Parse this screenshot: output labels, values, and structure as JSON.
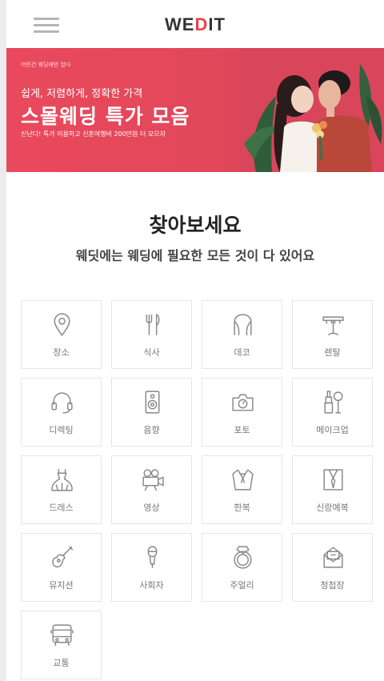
{
  "header": {
    "logo_pre": "WE",
    "logo_accent": "D",
    "logo_post": "IT"
  },
  "banner": {
    "small_text": "어린건 웨딩에만 있다",
    "subtitle": "쉽게, 저렴하게, 정확한 가격",
    "title": "스몰웨딩 특가 모음",
    "description": "신난다! 특가 이용하고 신혼여행비 200만원 더 모으자"
  },
  "section": {
    "heading": "찾아보세요",
    "subheading": "웨딧에는 웨딩에 필요한 모든 것이 다 있어요"
  },
  "categories": [
    {
      "label": "장소",
      "icon": "location-pin-icon"
    },
    {
      "label": "식사",
      "icon": "fork-knife-icon"
    },
    {
      "label": "데코",
      "icon": "arch-curtain-icon"
    },
    {
      "label": "렌탈",
      "icon": "table-rental-icon"
    },
    {
      "label": "디렉팅",
      "icon": "headset-icon"
    },
    {
      "label": "음향",
      "icon": "speaker-icon"
    },
    {
      "label": "포토",
      "icon": "camera-icon"
    },
    {
      "label": "메이크업",
      "icon": "makeup-icon"
    },
    {
      "label": "드레스",
      "icon": "dress-icon"
    },
    {
      "label": "영상",
      "icon": "video-camera-icon"
    },
    {
      "label": "한복",
      "icon": "hanbok-icon"
    },
    {
      "label": "신랑예복",
      "icon": "suit-icon"
    },
    {
      "label": "뮤지션",
      "icon": "guitar-icon"
    },
    {
      "label": "사회자",
      "icon": "microphone-icon"
    },
    {
      "label": "주얼리",
      "icon": "ring-icon"
    },
    {
      "label": "청첩장",
      "icon": "invitation-icon"
    },
    {
      "label": "교통",
      "icon": "bus-icon"
    }
  ]
}
